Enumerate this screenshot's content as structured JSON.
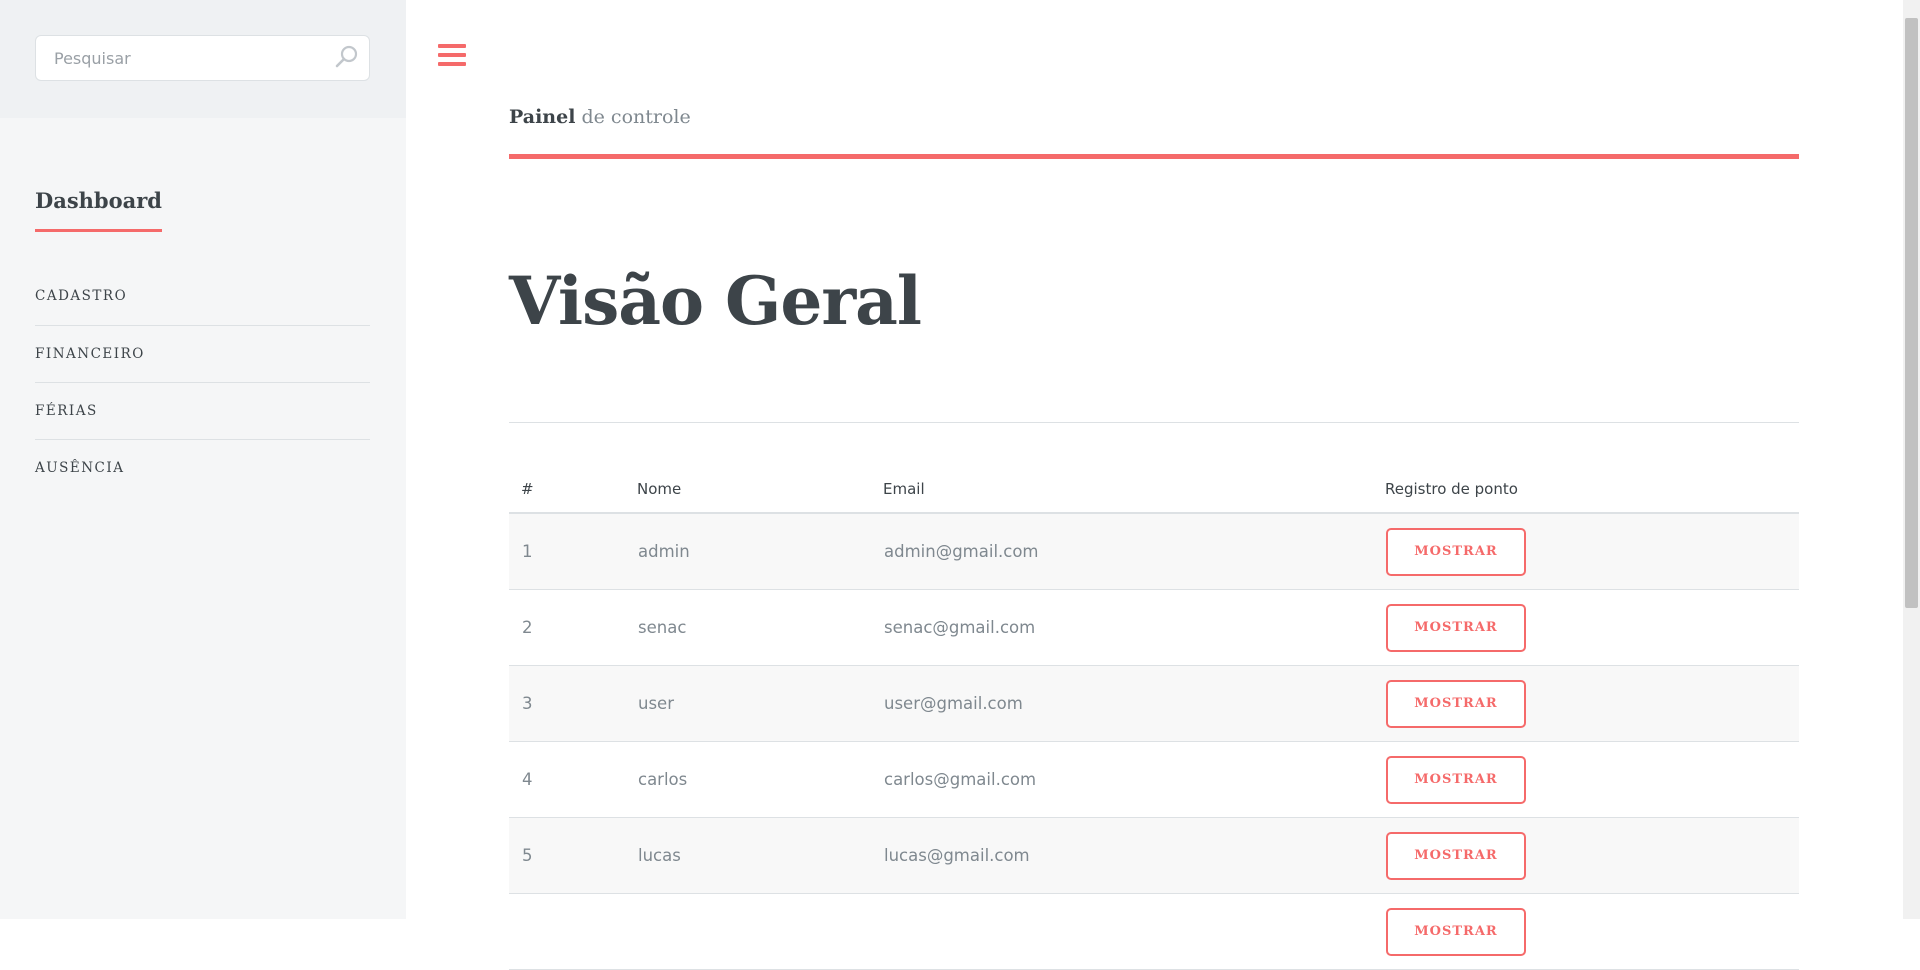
{
  "search": {
    "placeholder": "Pesquisar"
  },
  "sidebar": {
    "heading": "Dashboard",
    "items": [
      {
        "label": "CADASTRO"
      },
      {
        "label": "FINANCEIRO"
      },
      {
        "label": "FÉRIAS"
      },
      {
        "label": "AUSÊNCIA"
      }
    ]
  },
  "header": {
    "title_bold": "Painel",
    "title_rest": "de controle"
  },
  "main": {
    "title": "Visão Geral",
    "table": {
      "columns": [
        "#",
        "Nome",
        "Email",
        "Registro de ponto"
      ],
      "button_label": "MOSTRAR",
      "rows": [
        {
          "id": "1",
          "name": "admin",
          "email": "admin@gmail.com"
        },
        {
          "id": "2",
          "name": "senac",
          "email": "senac@gmail.com"
        },
        {
          "id": "3",
          "name": "user",
          "email": "user@gmail.com"
        },
        {
          "id": "4",
          "name": "carlos",
          "email": "carlos@gmail.com"
        },
        {
          "id": "5",
          "name": "lucas",
          "email": "lucas@gmail.com"
        },
        {
          "id": "",
          "name": "",
          "email": ""
        }
      ]
    }
  },
  "colors": {
    "accent": "#f56a6a",
    "text": "#3d4449",
    "muted": "#7f888f",
    "sidebar_bg": "#f5f6f7"
  }
}
